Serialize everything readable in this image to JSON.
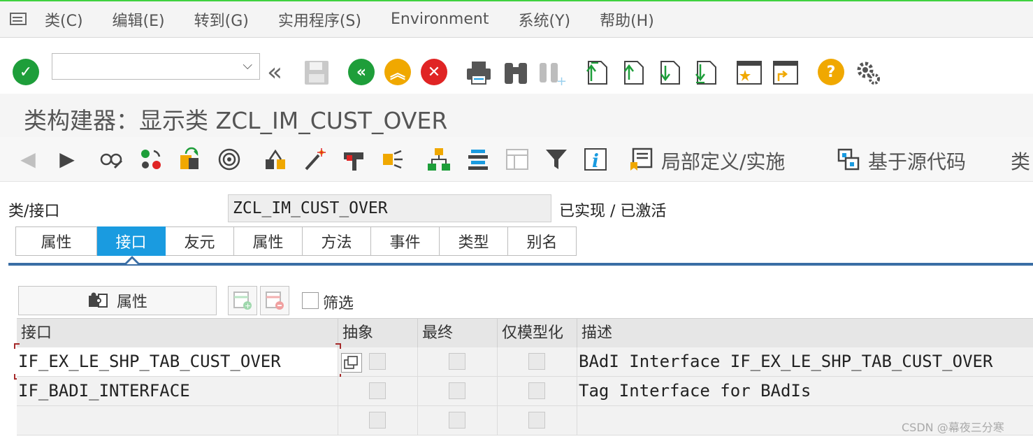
{
  "menu": {
    "items": [
      "类(C)",
      "编辑(E)",
      "转到(G)",
      "实用程序(S)",
      "Environment",
      "系统(Y)",
      "帮助(H)"
    ]
  },
  "toolbar": {
    "command_field_value": "",
    "icons": [
      "enter-icon",
      "command-dropdown-icon",
      "collapse-icon",
      "save-icon",
      "back-icon",
      "exit-icon",
      "cancel-icon",
      "print-icon",
      "find-icon",
      "find-next-icon",
      "first-page-icon",
      "previous-page-icon",
      "next-page-icon",
      "last-page-icon",
      "create-session-icon",
      "shortcut-icon",
      "help-icon",
      "settings-icon"
    ]
  },
  "title": "类构建器：显示类 ZCL_IM_CUST_OVER",
  "app_toolbar": {
    "local_definition_label": "局部定义/实施",
    "source_code_label": "基于源代码",
    "truncated_label": "类"
  },
  "class_row": {
    "label": "类/接口",
    "value": "ZCL_IM_CUST_OVER",
    "status": "已实现 / 已激活"
  },
  "tabs": [
    {
      "label": "属性",
      "active": false
    },
    {
      "label": "接口",
      "active": true
    },
    {
      "label": "友元",
      "active": false
    },
    {
      "label": "属性",
      "active": false
    },
    {
      "label": "方法",
      "active": false
    },
    {
      "label": "事件",
      "active": false
    },
    {
      "label": "类型",
      "active": false
    },
    {
      "label": "别名",
      "active": false
    }
  ],
  "actions": {
    "attributes_button": "属性",
    "filter_label": "筛选"
  },
  "table": {
    "columns": [
      "接口",
      "抽象",
      "最终",
      "仅模型化",
      "描述"
    ],
    "rows": [
      {
        "interface": "IF_EX_LE_SHP_TAB_CUST_OVER",
        "abstract": false,
        "final": false,
        "modeled_only": false,
        "description": "BAdI Interface IF_EX_LE_SHP_TAB_CUST_OVER"
      },
      {
        "interface": "IF_BADI_INTERFACE",
        "abstract": false,
        "final": false,
        "modeled_only": false,
        "description": "Tag Interface for BAdIs"
      },
      {
        "interface": "",
        "abstract": false,
        "final": false,
        "modeled_only": false,
        "description": ""
      }
    ]
  },
  "watermark": "CSDN @幕夜三分寒",
  "colors": {
    "accent_green": "#3fd23f",
    "tab_active": "#1a9be0",
    "tab_line": "#3a6ea5",
    "enter_green": "#1e9e3a",
    "nav_orange": "#f0a800",
    "cancel_red": "#e02424",
    "help_orange": "#f0a800"
  }
}
